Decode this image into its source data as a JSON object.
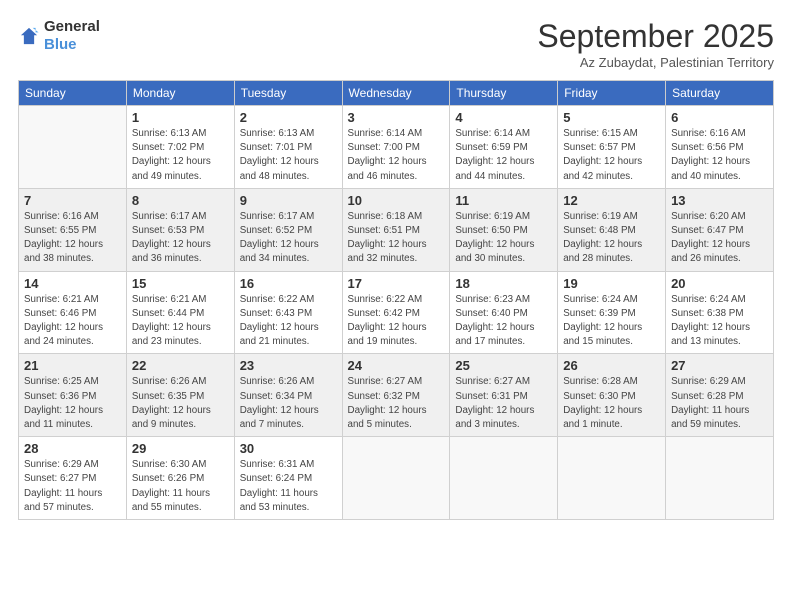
{
  "header": {
    "logo_general": "General",
    "logo_blue": "Blue",
    "month": "September 2025",
    "location": "Az Zubaydat, Palestinian Territory"
  },
  "weekdays": [
    "Sunday",
    "Monday",
    "Tuesday",
    "Wednesday",
    "Thursday",
    "Friday",
    "Saturday"
  ],
  "weeks": [
    [
      {
        "day": "",
        "info": ""
      },
      {
        "day": "1",
        "info": "Sunrise: 6:13 AM\nSunset: 7:02 PM\nDaylight: 12 hours\nand 49 minutes."
      },
      {
        "day": "2",
        "info": "Sunrise: 6:13 AM\nSunset: 7:01 PM\nDaylight: 12 hours\nand 48 minutes."
      },
      {
        "day": "3",
        "info": "Sunrise: 6:14 AM\nSunset: 7:00 PM\nDaylight: 12 hours\nand 46 minutes."
      },
      {
        "day": "4",
        "info": "Sunrise: 6:14 AM\nSunset: 6:59 PM\nDaylight: 12 hours\nand 44 minutes."
      },
      {
        "day": "5",
        "info": "Sunrise: 6:15 AM\nSunset: 6:57 PM\nDaylight: 12 hours\nand 42 minutes."
      },
      {
        "day": "6",
        "info": "Sunrise: 6:16 AM\nSunset: 6:56 PM\nDaylight: 12 hours\nand 40 minutes."
      }
    ],
    [
      {
        "day": "7",
        "info": "Sunrise: 6:16 AM\nSunset: 6:55 PM\nDaylight: 12 hours\nand 38 minutes."
      },
      {
        "day": "8",
        "info": "Sunrise: 6:17 AM\nSunset: 6:53 PM\nDaylight: 12 hours\nand 36 minutes."
      },
      {
        "day": "9",
        "info": "Sunrise: 6:17 AM\nSunset: 6:52 PM\nDaylight: 12 hours\nand 34 minutes."
      },
      {
        "day": "10",
        "info": "Sunrise: 6:18 AM\nSunset: 6:51 PM\nDaylight: 12 hours\nand 32 minutes."
      },
      {
        "day": "11",
        "info": "Sunrise: 6:19 AM\nSunset: 6:50 PM\nDaylight: 12 hours\nand 30 minutes."
      },
      {
        "day": "12",
        "info": "Sunrise: 6:19 AM\nSunset: 6:48 PM\nDaylight: 12 hours\nand 28 minutes."
      },
      {
        "day": "13",
        "info": "Sunrise: 6:20 AM\nSunset: 6:47 PM\nDaylight: 12 hours\nand 26 minutes."
      }
    ],
    [
      {
        "day": "14",
        "info": "Sunrise: 6:21 AM\nSunset: 6:46 PM\nDaylight: 12 hours\nand 24 minutes."
      },
      {
        "day": "15",
        "info": "Sunrise: 6:21 AM\nSunset: 6:44 PM\nDaylight: 12 hours\nand 23 minutes."
      },
      {
        "day": "16",
        "info": "Sunrise: 6:22 AM\nSunset: 6:43 PM\nDaylight: 12 hours\nand 21 minutes."
      },
      {
        "day": "17",
        "info": "Sunrise: 6:22 AM\nSunset: 6:42 PM\nDaylight: 12 hours\nand 19 minutes."
      },
      {
        "day": "18",
        "info": "Sunrise: 6:23 AM\nSunset: 6:40 PM\nDaylight: 12 hours\nand 17 minutes."
      },
      {
        "day": "19",
        "info": "Sunrise: 6:24 AM\nSunset: 6:39 PM\nDaylight: 12 hours\nand 15 minutes."
      },
      {
        "day": "20",
        "info": "Sunrise: 6:24 AM\nSunset: 6:38 PM\nDaylight: 12 hours\nand 13 minutes."
      }
    ],
    [
      {
        "day": "21",
        "info": "Sunrise: 6:25 AM\nSunset: 6:36 PM\nDaylight: 12 hours\nand 11 minutes."
      },
      {
        "day": "22",
        "info": "Sunrise: 6:26 AM\nSunset: 6:35 PM\nDaylight: 12 hours\nand 9 minutes."
      },
      {
        "day": "23",
        "info": "Sunrise: 6:26 AM\nSunset: 6:34 PM\nDaylight: 12 hours\nand 7 minutes."
      },
      {
        "day": "24",
        "info": "Sunrise: 6:27 AM\nSunset: 6:32 PM\nDaylight: 12 hours\nand 5 minutes."
      },
      {
        "day": "25",
        "info": "Sunrise: 6:27 AM\nSunset: 6:31 PM\nDaylight: 12 hours\nand 3 minutes."
      },
      {
        "day": "26",
        "info": "Sunrise: 6:28 AM\nSunset: 6:30 PM\nDaylight: 12 hours\nand 1 minute."
      },
      {
        "day": "27",
        "info": "Sunrise: 6:29 AM\nSunset: 6:28 PM\nDaylight: 11 hours\nand 59 minutes."
      }
    ],
    [
      {
        "day": "28",
        "info": "Sunrise: 6:29 AM\nSunset: 6:27 PM\nDaylight: 11 hours\nand 57 minutes."
      },
      {
        "day": "29",
        "info": "Sunrise: 6:30 AM\nSunset: 6:26 PM\nDaylight: 11 hours\nand 55 minutes."
      },
      {
        "day": "30",
        "info": "Sunrise: 6:31 AM\nSunset: 6:24 PM\nDaylight: 11 hours\nand 53 minutes."
      },
      {
        "day": "",
        "info": ""
      },
      {
        "day": "",
        "info": ""
      },
      {
        "day": "",
        "info": ""
      },
      {
        "day": "",
        "info": ""
      }
    ]
  ]
}
